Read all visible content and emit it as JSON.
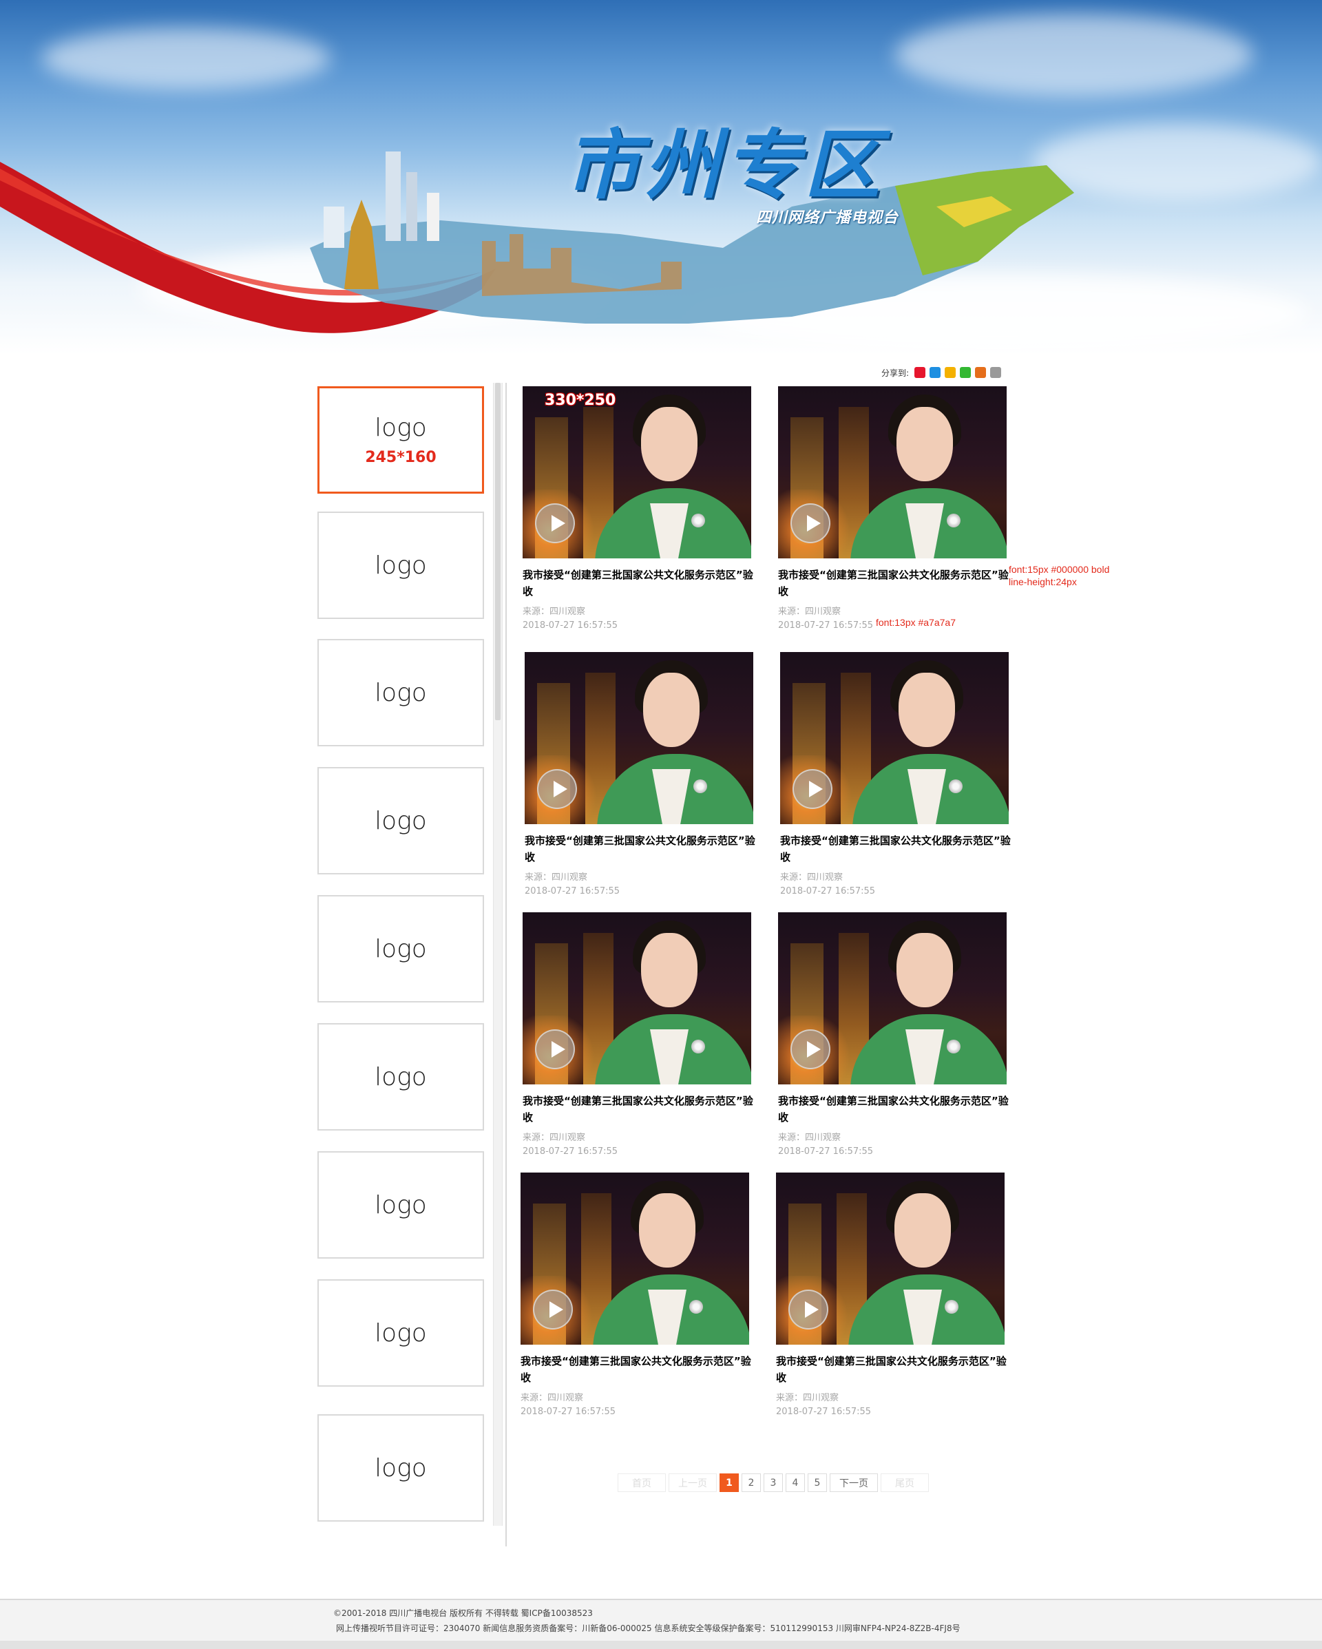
{
  "banner": {
    "title": "市州专区",
    "subtitle": "四川网络广播电视台"
  },
  "share": {
    "label": "分享到:",
    "icons": [
      {
        "name": "weibo-icon",
        "color": "#e6162d"
      },
      {
        "name": "qq-icon",
        "color": "#1e8fe1"
      },
      {
        "name": "qzone-icon",
        "color": "#f4b100"
      },
      {
        "name": "wechat-icon",
        "color": "#33b832"
      },
      {
        "name": "renren-icon",
        "color": "#e56e1b"
      },
      {
        "name": "more-share-icon",
        "color": "#9a9a9a"
      }
    ]
  },
  "sidebar": {
    "logos": [
      {
        "label": "logo",
        "size": "245*160",
        "active": true
      },
      {
        "label": "logo"
      },
      {
        "label": "logo"
      },
      {
        "label": "logo"
      },
      {
        "label": "logo"
      },
      {
        "label": "logo"
      },
      {
        "label": "logo"
      },
      {
        "label": "logo"
      },
      {
        "label": "logo"
      }
    ]
  },
  "videos": {
    "thumb_size_label": "330*250",
    "items": [
      {
        "title": "我市接受“创建第三批国家公共文化服务示范区”验收",
        "source": "来源：四川观察",
        "date": "2018-07-27 16:57:55"
      },
      {
        "title": "我市接受“创建第三批国家公共文化服务示范区”验收",
        "source": "来源：四川观察",
        "date": "2018-07-27 16:57:55"
      },
      {
        "title": "我市接受“创建第三批国家公共文化服务示范区”验收",
        "source": "来源：四川观察",
        "date": "2018-07-27 16:57:55"
      },
      {
        "title": "我市接受“创建第三批国家公共文化服务示范区”验收",
        "source": "来源：四川观察",
        "date": "2018-07-27 16:57:55"
      },
      {
        "title": "我市接受“创建第三批国家公共文化服务示范区”验收",
        "source": "来源：四川观察",
        "date": "2018-07-27 16:57:55"
      },
      {
        "title": "我市接受“创建第三批国家公共文化服务示范区”验收",
        "source": "来源：四川观察",
        "date": "2018-07-27 16:57:55"
      },
      {
        "title": "我市接受“创建第三批国家公共文化服务示范区”验收",
        "source": "来源：四川观察",
        "date": "2018-07-27 16:57:55"
      },
      {
        "title": "我市接受“创建第三批国家公共文化服务示范区”验收",
        "source": "来源：四川观察",
        "date": "2018-07-27 16:57:55"
      }
    ]
  },
  "annotations": {
    "title_spec_1": "font:15px #000000 bold",
    "title_spec_2": "line-height:24px",
    "meta_spec": "font:13px #a7a7a7"
  },
  "pagination": {
    "first": "首页",
    "prev": "上一页",
    "pages": [
      "1",
      "2",
      "3",
      "4",
      "5"
    ],
    "current": "1",
    "next": "下一页",
    "last": "尾页"
  },
  "footer": {
    "line1": "©2001-2018 四川广播电视台 版权所有 不得转载  蜀ICP备10038523",
    "line2": "网上传播视听节目许可证号：2304070   新闻信息服务资质备案号：川新备06-000025   信息系统安全等级保护备案号：510112990153   川网审NFP4-NP24-8Z2B-4FJ8号"
  },
  "colors": {
    "accent": "#f05a1e",
    "annotation": "#e32a1c",
    "meta_text": "#a7a7a7"
  }
}
